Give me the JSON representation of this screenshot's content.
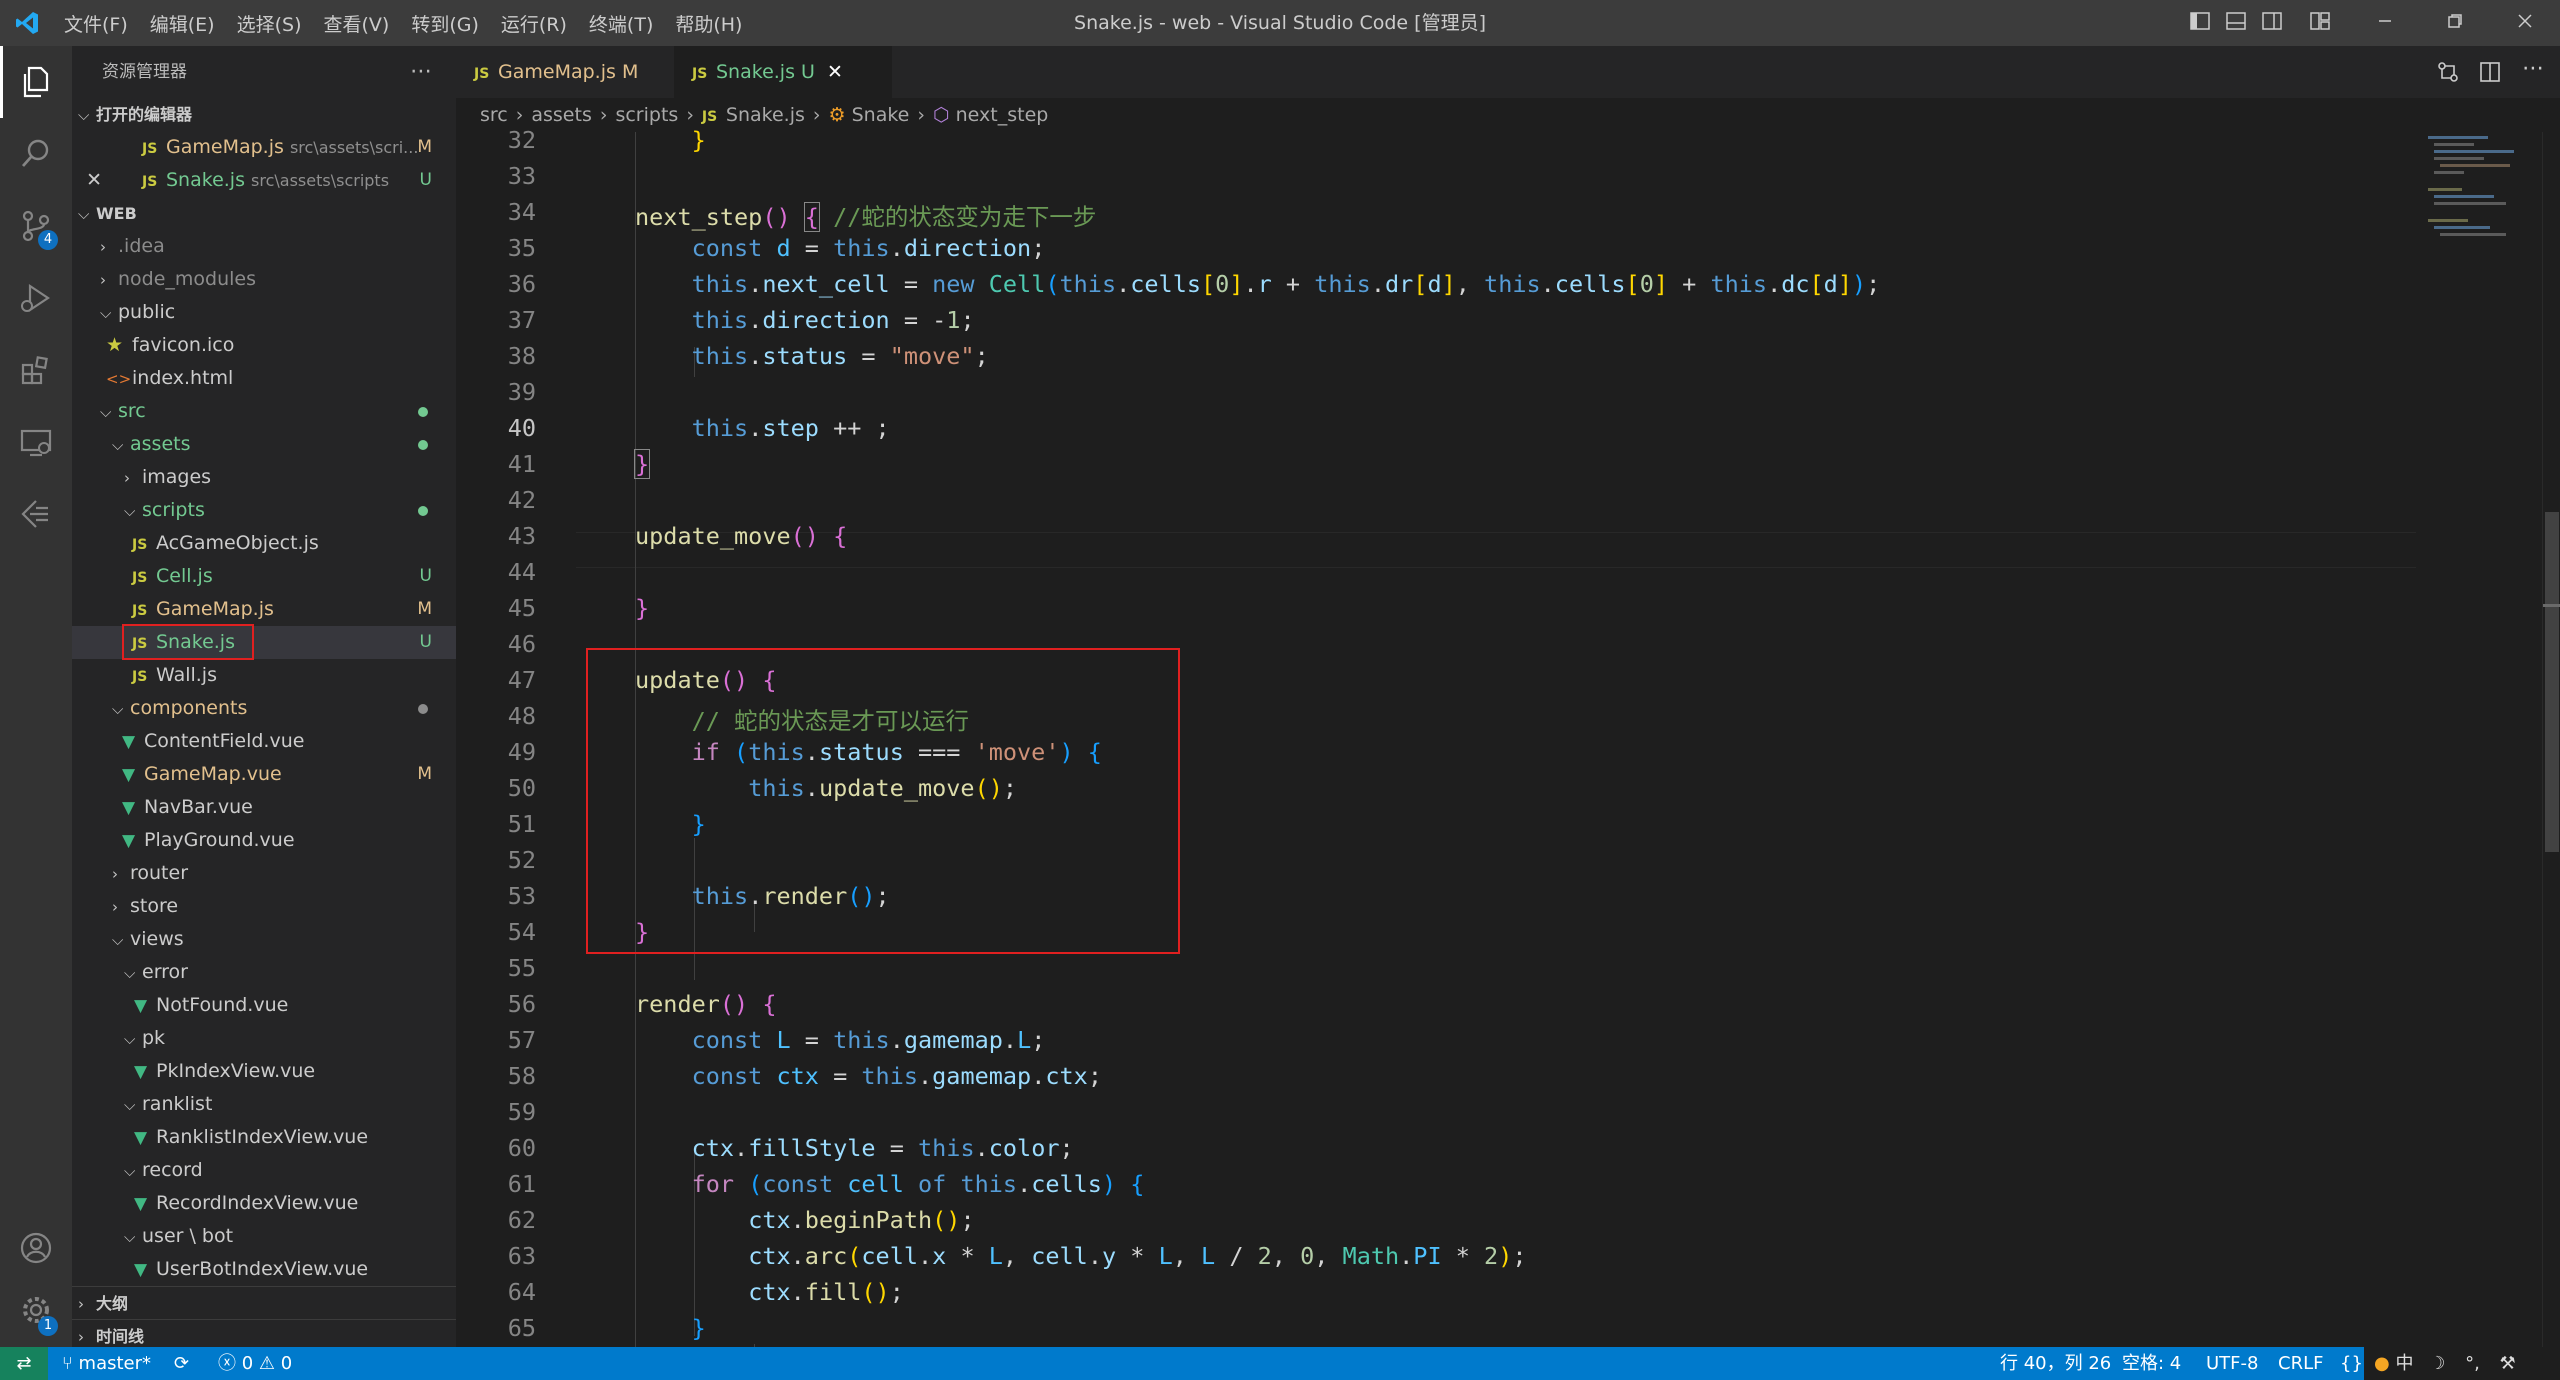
{
  "titlebar": {
    "menu": [
      "文件(F)",
      "编辑(E)",
      "选择(S)",
      "查看(V)",
      "转到(G)",
      "运行(R)",
      "终端(T)",
      "帮助(H)"
    ],
    "title": "Snake.js - web - Visual Studio Code [管理员]"
  },
  "activity": {
    "scm_badge": "4",
    "settings_badge": "1"
  },
  "sidebar": {
    "title": "资源管理器",
    "open_editors_title": "打开的编辑器",
    "open_editors": [
      {
        "name": "GameMap.js",
        "path": "src\\assets\\scri...",
        "status": "M"
      },
      {
        "name": "Snake.js",
        "path": "src\\assets\\scripts",
        "status": "U"
      }
    ],
    "workspace_title": "WEB",
    "tree": [
      {
        "label": ".idea"
      },
      {
        "label": "node_modules"
      },
      {
        "label": "public"
      },
      {
        "label": "favicon.ico"
      },
      {
        "label": "index.html"
      },
      {
        "label": "src"
      },
      {
        "label": "assets"
      },
      {
        "label": "images"
      },
      {
        "label": "scripts"
      },
      {
        "label": "AcGameObject.js"
      },
      {
        "label": "Cell.js",
        "status": "U"
      },
      {
        "label": "GameMap.js",
        "status": "M"
      },
      {
        "label": "Snake.js",
        "status": "U"
      },
      {
        "label": "Wall.js"
      },
      {
        "label": "components"
      },
      {
        "label": "ContentField.vue"
      },
      {
        "label": "GameMap.vue",
        "status": "M"
      },
      {
        "label": "NavBar.vue"
      },
      {
        "label": "PlayGround.vue"
      },
      {
        "label": "router"
      },
      {
        "label": "store"
      },
      {
        "label": "views"
      },
      {
        "label": "error"
      },
      {
        "label": "NotFound.vue"
      },
      {
        "label": "pk"
      },
      {
        "label": "PkIndexView.vue"
      },
      {
        "label": "ranklist"
      },
      {
        "label": "RanklistIndexView.vue"
      },
      {
        "label": "record"
      },
      {
        "label": "RecordIndexView.vue"
      },
      {
        "label": "user \\ bot"
      },
      {
        "label": "UserBotIndexView.vue"
      }
    ],
    "outline_title": "大纲",
    "timeline_title": "时间线"
  },
  "tabs": [
    {
      "label": "GameMap.js",
      "status": "M"
    },
    {
      "label": "Snake.js",
      "status": "U"
    }
  ],
  "breadcrumb": [
    "src",
    "assets",
    "scripts",
    "Snake.js",
    "Snake",
    "next_step"
  ],
  "editor": {
    "line_numbers": [
      "32",
      "33",
      "34",
      "35",
      "36",
      "37",
      "38",
      "39",
      "40",
      "41",
      "42",
      "43",
      "44",
      "45",
      "46",
      "47",
      "48",
      "49",
      "50",
      "51",
      "52",
      "53",
      "54",
      "55",
      "56",
      "57",
      "58",
      "59",
      "60",
      "61",
      "62",
      "63",
      "64",
      "65"
    ],
    "current_line": "40"
  },
  "statusbar": {
    "branch": "master*",
    "errors": "0",
    "warnings": "0",
    "position": "行 40，列 26",
    "spaces": "空格: 4",
    "encoding": "UTF-8",
    "eol": "CRLF",
    "language": "{}",
    "ime": "中"
  }
}
